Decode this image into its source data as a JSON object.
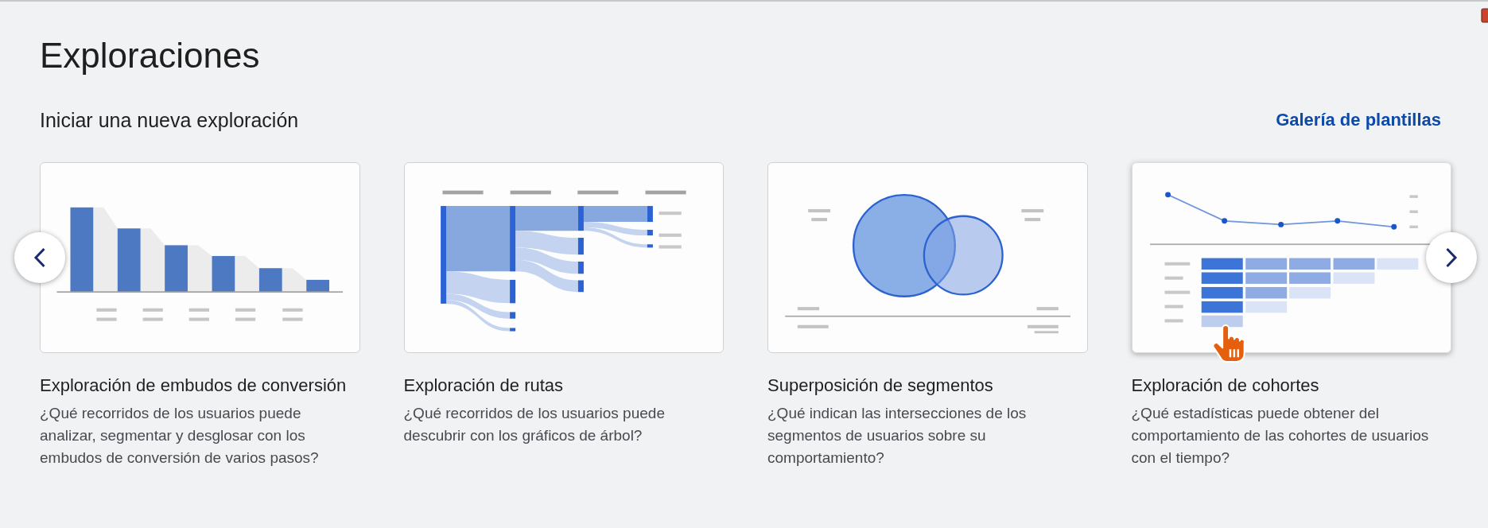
{
  "page": {
    "title": "Exploraciones"
  },
  "section": {
    "heading": "Iniciar una nueva exploración",
    "gallery_link": "Galería de plantillas"
  },
  "templates": [
    {
      "kind": "funnel",
      "hovered": false,
      "title": "Exploración de embudos de conversión",
      "description": "¿Qué recorridos de los usuarios puede analizar, segmentar y desglosar con los embudos de conversión de varios pasos?"
    },
    {
      "kind": "path",
      "hovered": false,
      "title": "Exploración de rutas",
      "description": "¿Qué recorridos de los usuarios puede descubrir con los gráficos de árbol?"
    },
    {
      "kind": "segment_overlap",
      "hovered": false,
      "title": "Superposición de segmentos",
      "description": "¿Qué indican las intersecciones de los segmentos de usuarios sobre su comportamiento?"
    },
    {
      "kind": "cohort",
      "hovered": true,
      "title": "Exploración de cohortes",
      "description": "¿Qué estadísticas puede obtener del comportamiento de las cohortes de usuarios con el tiempo?"
    }
  ]
}
